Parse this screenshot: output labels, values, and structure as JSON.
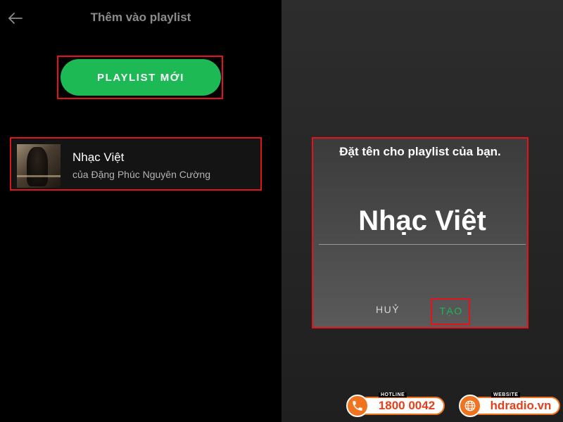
{
  "left": {
    "header": {
      "title": "Thêm vào playlist",
      "back_icon": "arrow-left-icon"
    },
    "new_playlist_button": "PLAYLIST MỚI",
    "playlists": [
      {
        "title": "Nhạc Việt",
        "subtitle": "của Đặng Phúc Nguyên Cường",
        "cover_icon": "album-cover-image"
      }
    ]
  },
  "dialog": {
    "title": "Đặt tên cho playlist của bạn.",
    "name_value": "Nhạc Việt",
    "cancel_label": "HUỶ",
    "create_label": "TẠO"
  },
  "footer": {
    "hotline": {
      "caption": "HOTLINE",
      "value": "1800 0042",
      "icon": "phone-icon"
    },
    "website": {
      "caption": "WEBSITE",
      "value": "hdradio.vn",
      "icon": "globe-icon"
    }
  },
  "colors": {
    "accent": "#1db954",
    "highlight_box": "#e4121b",
    "badge_orange": "#f0731f"
  }
}
